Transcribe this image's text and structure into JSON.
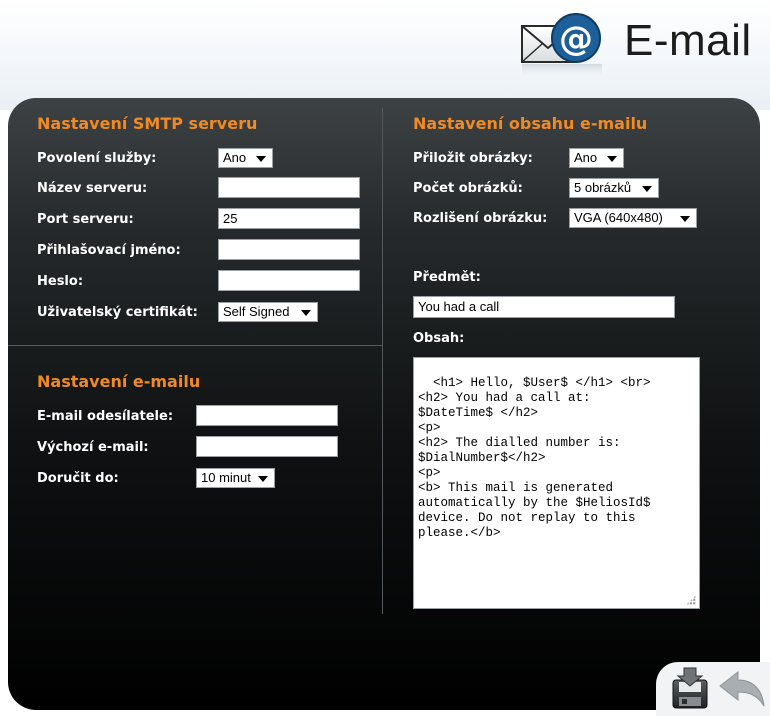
{
  "header": {
    "title": "E-mail",
    "icon": "email-at-icon"
  },
  "smtp": {
    "title": "Nastavení SMTP serveru",
    "fields": {
      "service": {
        "label": "Povolení služby:",
        "value": "Ano"
      },
      "server_name": {
        "label": "Název serveru:",
        "value": ""
      },
      "port": {
        "label": "Port serveru:",
        "value": "25"
      },
      "login": {
        "label": "Přihlašovací jméno:",
        "value": ""
      },
      "password": {
        "label": "Heslo:",
        "value": ""
      },
      "certificate": {
        "label": "Uživatelský certifikát:",
        "value": "Self Signed"
      }
    }
  },
  "email_settings": {
    "title": "Nastavení e-mailu",
    "fields": {
      "sender": {
        "label": "E-mail odesílatele:",
        "value": ""
      },
      "default_email": {
        "label": "Výchozí e-mail:",
        "value": ""
      },
      "deliver_until": {
        "label": "Doručit do:",
        "value": "10 minut"
      }
    }
  },
  "content": {
    "title": "Nastavení obsahu e-mailu",
    "fields": {
      "attach_images": {
        "label": "Přiložit obrázky:",
        "value": "Ano"
      },
      "image_count": {
        "label": "Počet obrázků:",
        "value": "5 obrázků"
      },
      "resolution": {
        "label": "Rozlišení obrázku:",
        "value": "VGA (640x480)"
      },
      "subject": {
        "label": "Předmět:",
        "value": "You had a call"
      },
      "body": {
        "label": "Obsah:",
        "value": "<h1> Hello, $User$ </h1> <br>\n<h2> You had a call at:\n$DateTime$ </h2>\n<p>\n<h2> The dialled number is:\n$DialNumber$</h2>\n<p>\n<b> This mail is generated\nautomatically by the $HeliosId$\ndevice. Do not replay to this\nplease.</b>"
      }
    }
  },
  "actions": {
    "save_icon": "save-icon",
    "back_icon": "back-arrow-icon"
  }
}
